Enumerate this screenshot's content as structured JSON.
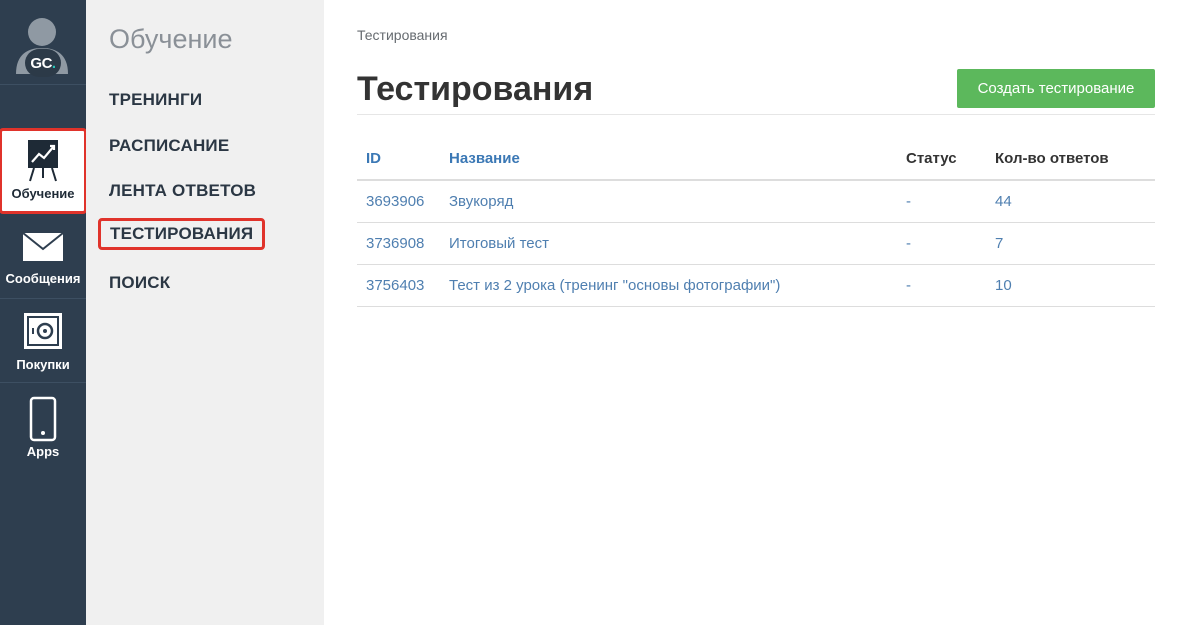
{
  "avatar": {
    "initials_main": "GC",
    "initials_accent": "."
  },
  "rail": {
    "items": [
      {
        "label": "Обучение",
        "icon": "presentation-chart-icon",
        "active": true
      },
      {
        "label": "Сообщения",
        "icon": "envelope-icon",
        "active": false
      },
      {
        "label": "Покупки",
        "icon": "safe-icon",
        "active": false
      },
      {
        "label": "Apps",
        "icon": "smartphone-icon",
        "active": false
      }
    ]
  },
  "sidebar": {
    "title": "Обучение",
    "items": [
      {
        "label": "ТРЕНИНГИ",
        "active": false
      },
      {
        "label": "РАСПИСАНИЕ",
        "active": false
      },
      {
        "label": "ЛЕНТА ОТВЕТОВ",
        "active": false
      },
      {
        "label": "ТЕСТИРОВАНИЯ",
        "active": true
      },
      {
        "label": "ПОИСК",
        "active": false
      }
    ]
  },
  "main": {
    "breadcrumb": "Тестирования",
    "title": "Тестирования",
    "create_button_label": "Создать тестирование",
    "table": {
      "columns": [
        "ID",
        "Название",
        "Статус",
        "Кол-во ответов"
      ],
      "rows": [
        {
          "id": "3693906",
          "name": "Звукоряд",
          "status": "-",
          "answers": "44"
        },
        {
          "id": "3736908",
          "name": "Итоговый тест",
          "status": "-",
          "answers": "7"
        },
        {
          "id": "3756403",
          "name": "Тест из 2 урока (тренинг \"основы фотографии\")",
          "status": "-",
          "answers": "10"
        }
      ]
    }
  },
  "colors": {
    "rail_bg": "#2e3e4f",
    "sidebar_bg": "#f0f0f0",
    "highlight_outline": "#e0332b",
    "primary_button": "#5cb85c",
    "link": "#4f7fb0"
  }
}
